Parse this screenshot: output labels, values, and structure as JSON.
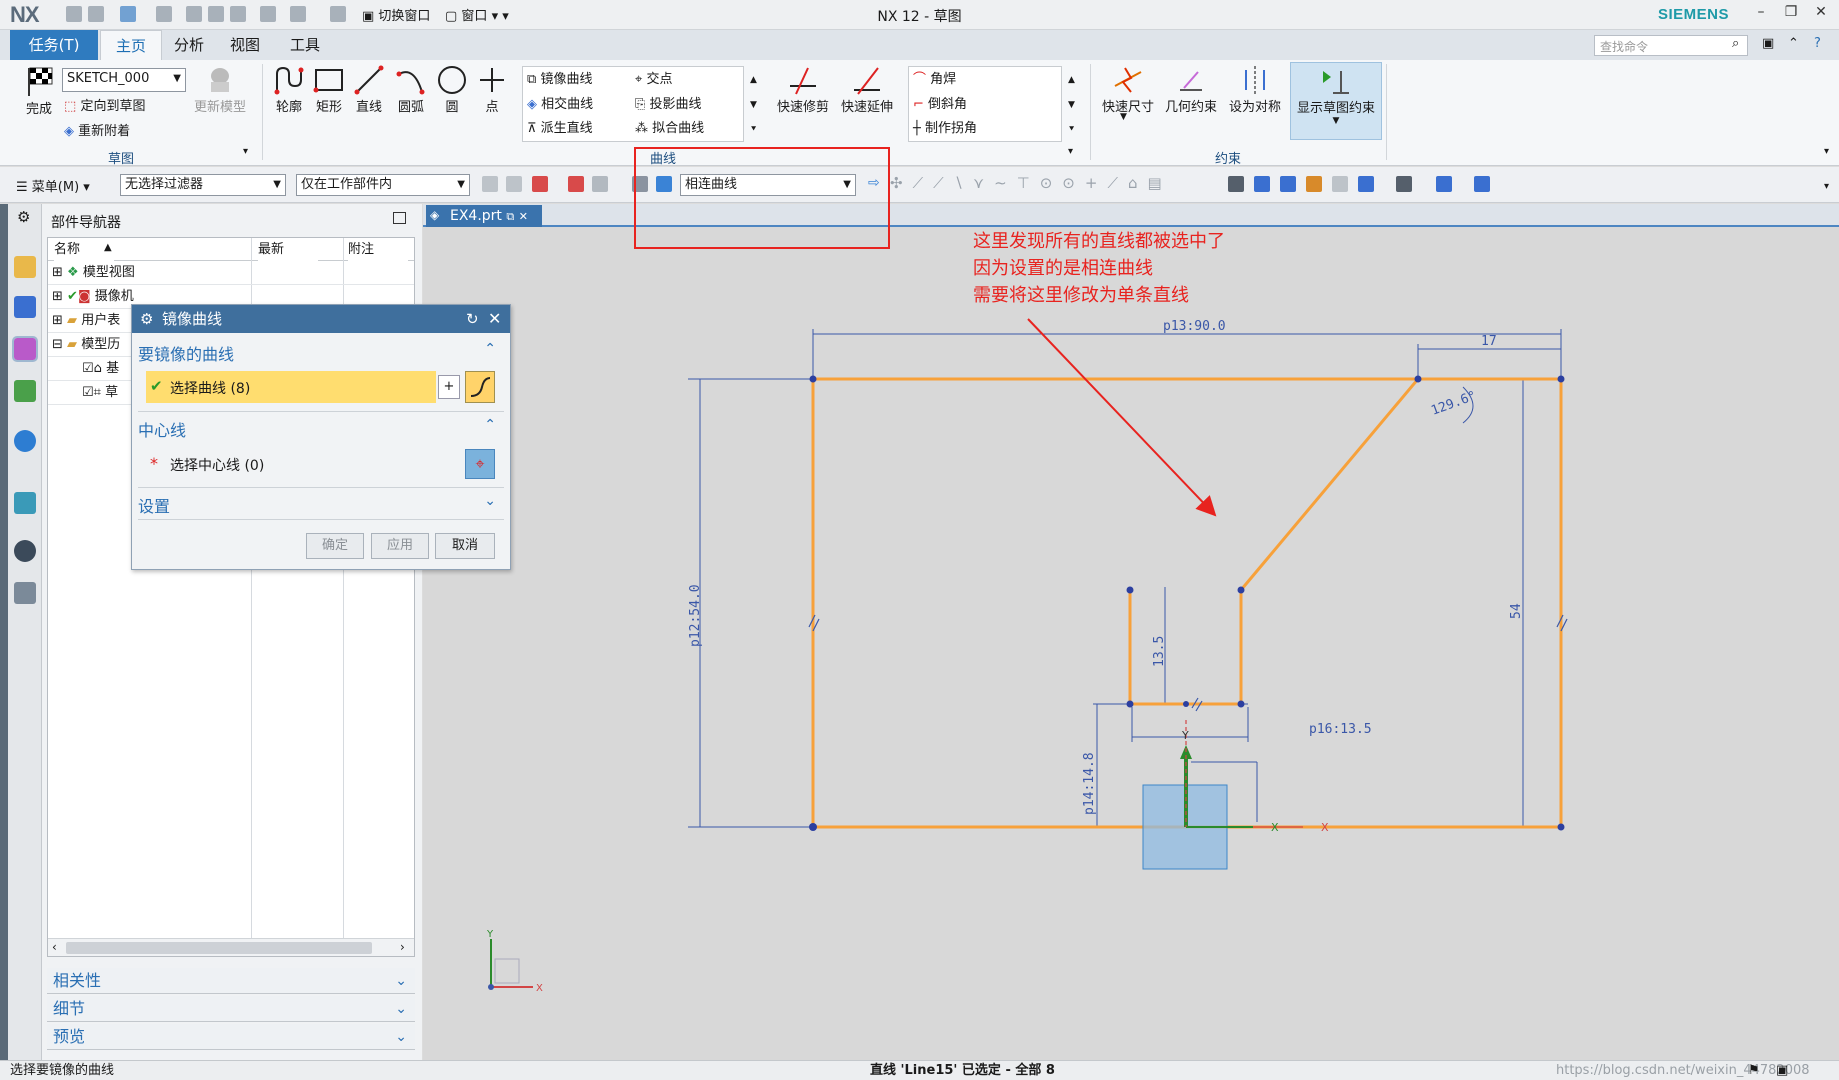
{
  "titlebar": {
    "app_logo": "NX",
    "title": "NX 12 - 草图",
    "switch_window": "切换窗口",
    "window_menu": "窗口",
    "brand": "SIEMENS"
  },
  "ribbon_tabs": [
    "任务(T)",
    "主页",
    "分析",
    "视图",
    "工具"
  ],
  "search": {
    "placeholder": "查找命令"
  },
  "ribbon": {
    "sketch_group": {
      "finish": "完成",
      "sketch_name": "SKETCH_000",
      "orient": "定向到草图",
      "reattach": "重新附着",
      "update_model": "更新模型",
      "label": "草图"
    },
    "curve_tools": [
      "轮廓",
      "矩形",
      "直线",
      "圆弧",
      "圆",
      "点"
    ],
    "curve_gallery": [
      [
        "镜像曲线",
        "交点"
      ],
      [
        "相交曲线",
        "投影曲线"
      ],
      [
        "派生直线",
        "拟合曲线"
      ]
    ],
    "curve_label": "曲线",
    "quick_trim": "快速修剪",
    "quick_extend": "快速延伸",
    "corner_gallery": [
      "角焊",
      "倒斜角",
      "制作拐角"
    ],
    "constraint_tools": [
      "快速尺寸",
      "几何约束",
      "设为对称",
      "显示草图约束"
    ],
    "constraint_label": "约束"
  },
  "toolbar2": {
    "menu": "菜单(M)",
    "filter": "无选择过滤器",
    "scope": "仅在工作部件内",
    "curve_rule": "相连曲线"
  },
  "navigator": {
    "title": "部件导航器",
    "columns": [
      "名称",
      "最新",
      "附注"
    ],
    "rows": [
      "模型视图",
      "摄像机",
      "用户表",
      "模型历",
      "基",
      "草"
    ],
    "sections": [
      "相关性",
      "细节",
      "预览"
    ]
  },
  "dialog": {
    "title": "镜像曲线",
    "section_curves": "要镜像的曲线",
    "select_curve": "选择曲线 (8)",
    "section_center": "中心线",
    "select_center": "选择中心线 (0)",
    "section_settings": "设置",
    "ok": "确定",
    "apply": "应用",
    "cancel": "取消"
  },
  "document_tab": "EX4.prt",
  "annotation": [
    "这里发现所有的直线都被选中了",
    "因为设置的是相连曲线",
    "需要将这里修改为单条直线"
  ],
  "sketch": {
    "dims": {
      "top": "p13:90.0",
      "right_top": "17",
      "angle": "129.6°",
      "left": "p12:54.0",
      "right": "54",
      "slot_depth": "13.5",
      "slot_width": "p16:13.5",
      "bottom_small": "p14:14.8"
    },
    "axis": {
      "x": "X",
      "y": "Y"
    }
  },
  "status": {
    "left": "选择要镜像的曲线",
    "center": "直线 'Line15' 已选定 - 全部 8",
    "watermark": "https://blog.csdn.net/weixin_44782008"
  },
  "colors": {
    "accent": "#2f7bbf",
    "selection": "#f7a13a",
    "annotation": "#e8231f",
    "highlight": "#ffdd6f"
  }
}
